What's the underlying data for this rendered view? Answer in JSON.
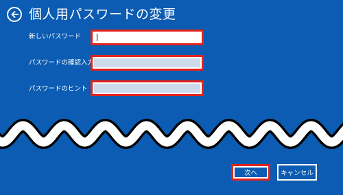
{
  "header": {
    "back_icon": "back-arrow-icon",
    "title": "個人用パスワードの変更"
  },
  "form": {
    "fields": [
      {
        "label": "新しいパスワード",
        "value": "",
        "state": "focused"
      },
      {
        "label": "パスワードの確認入力",
        "value": "",
        "state": "disabled"
      },
      {
        "label": "パスワードのヒント",
        "value": "",
        "state": "disabled"
      }
    ]
  },
  "footer": {
    "next_label": "次へ",
    "cancel_label": "キャンセル"
  },
  "colors": {
    "background": "#0b5cb2",
    "highlight_border": "#e2231a",
    "disabled_field": "#cddbea"
  }
}
